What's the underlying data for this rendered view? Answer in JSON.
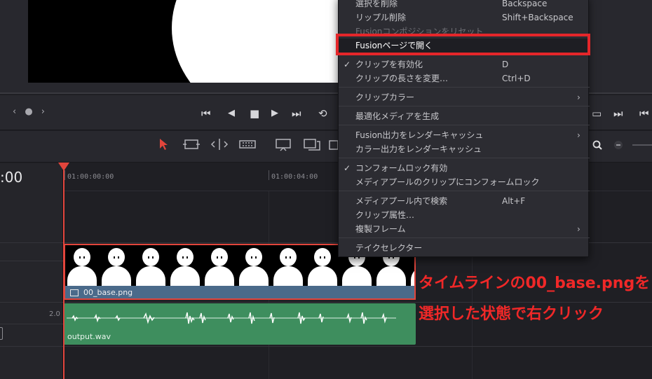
{
  "context_menu": {
    "items": [
      {
        "label": "選択を削除",
        "shortcut": "Backspace"
      },
      {
        "label": "リップル削除",
        "shortcut": "Shift+Backspace"
      },
      {
        "label": "Fusionコンポジションをリセット",
        "disabled": true
      },
      {
        "label": "Fusionページで開く",
        "highlighted": true
      },
      {
        "label": "クリップを有効化",
        "shortcut": "D",
        "checked": true
      },
      {
        "label": "クリップの長さを変更…",
        "shortcut": "Ctrl+D"
      },
      {
        "label": "クリップカラー",
        "submenu": true
      },
      {
        "label": "最適化メディアを生成"
      },
      {
        "label": "Fusion出力をレンダーキャッシュ",
        "submenu": true
      },
      {
        "label": "カラー出力をレンダーキャッシュ"
      },
      {
        "label": "コンフォームロック有効",
        "checked": true
      },
      {
        "label": "メディアプールのクリップにコンフォームロック"
      },
      {
        "label": "メディアプール内で検索",
        "shortcut": "Alt+F"
      },
      {
        "label": "クリップ属性…"
      },
      {
        "label": "複製フレーム",
        "submenu": true
      },
      {
        "label": "テイクセレクター"
      }
    ],
    "check_glyph": "✓",
    "submenu_glyph": "›"
  },
  "timeline": {
    "timecode": ":00",
    "ruler_ticks": [
      "01:00:00:00",
      "01:00:04:00"
    ],
    "video_clip_name": "00_base.png",
    "audio_clip_name": "output.wav",
    "audio_level": "2.0"
  },
  "transport": {
    "nav": "‹ ● ›",
    "buttons": [
      "⏮",
      "◀",
      "■",
      "▶",
      "⏭",
      "⟲"
    ],
    "right_buttons": [
      "▭",
      "⏭",
      "⏮"
    ]
  },
  "annotation": {
    "line1": "タイムラインの00_base.pngを",
    "line2": "選択した状態で右クリック",
    "color": "#f02828"
  },
  "colors": {
    "highlight_box": "#e5262a",
    "playhead": "#e2453c",
    "video_clip": "#4a6a8a",
    "audio_clip": "#3e8e5e"
  }
}
